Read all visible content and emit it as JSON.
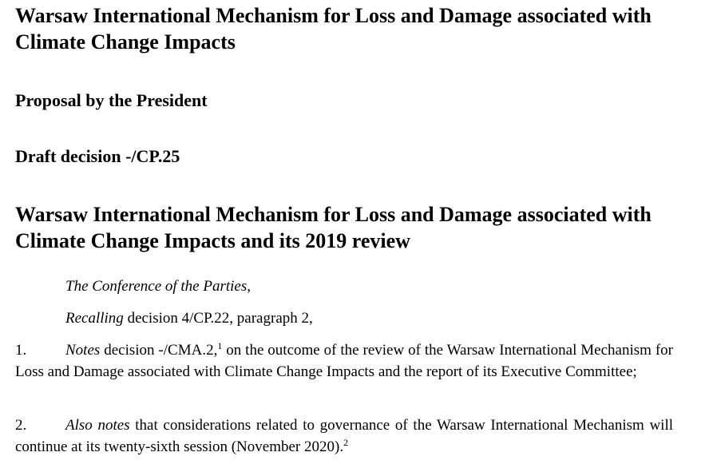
{
  "document": {
    "main_heading": "Warsaw International Mechanism for Loss and Damage associated with Climate Change Impacts",
    "proposal_heading": "Proposal by the President",
    "draft_heading": "Draft decision -/CP.25",
    "decision_title": "Warsaw International Mechanism for Loss and Damage associated with Climate Change Impacts and its 2019 review",
    "preamble": {
      "actor": "The Conference of the Parties,",
      "recalling_italic": "Recalling",
      "recalling_rest": " decision 4/CP.22, paragraph 2,"
    },
    "paragraphs": [
      {
        "number": "1.",
        "italic_lead": "Notes",
        "text_before_note": " decision -/CMA.2,",
        "footnote_ref": "1",
        "text_after_note": " on the outcome of the review of the Warsaw International Mechanism for Loss and Damage associated with Climate Change Impacts and the report of its Executive Committee;"
      },
      {
        "number": "2.",
        "italic_lead": "Also notes",
        "text_before_note": " that considerations related to governance of the Warsaw International Mechanism will continue at its twenty-sixth session (November 2020).",
        "footnote_ref": "2",
        "text_after_note": ""
      }
    ]
  }
}
